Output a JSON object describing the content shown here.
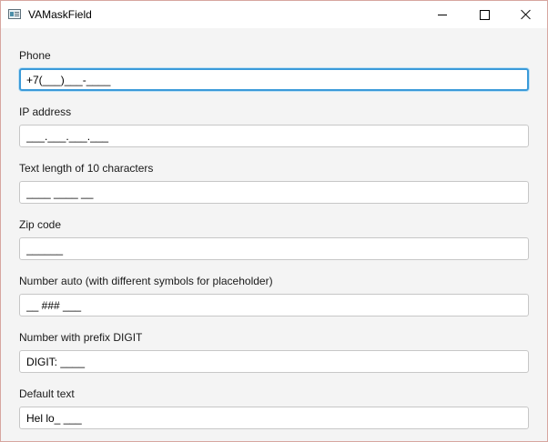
{
  "window": {
    "title": "VAMaskField"
  },
  "fields": [
    {
      "label": "Phone",
      "value": "+7(___)___-____"
    },
    {
      "label": "IP address",
      "value": "___.___.___.___"
    },
    {
      "label": "Text length of 10 characters",
      "value": "____ ____ __"
    },
    {
      "label": "Zip code",
      "value": "______"
    },
    {
      "label": "Number auto (with different symbols for placeholder)",
      "value": "__ ### ___"
    },
    {
      "label": "Number with prefix DIGIT",
      "value": "DIGIT: ____"
    },
    {
      "label": "Default text",
      "value": "Hel lo_ ___"
    }
  ]
}
